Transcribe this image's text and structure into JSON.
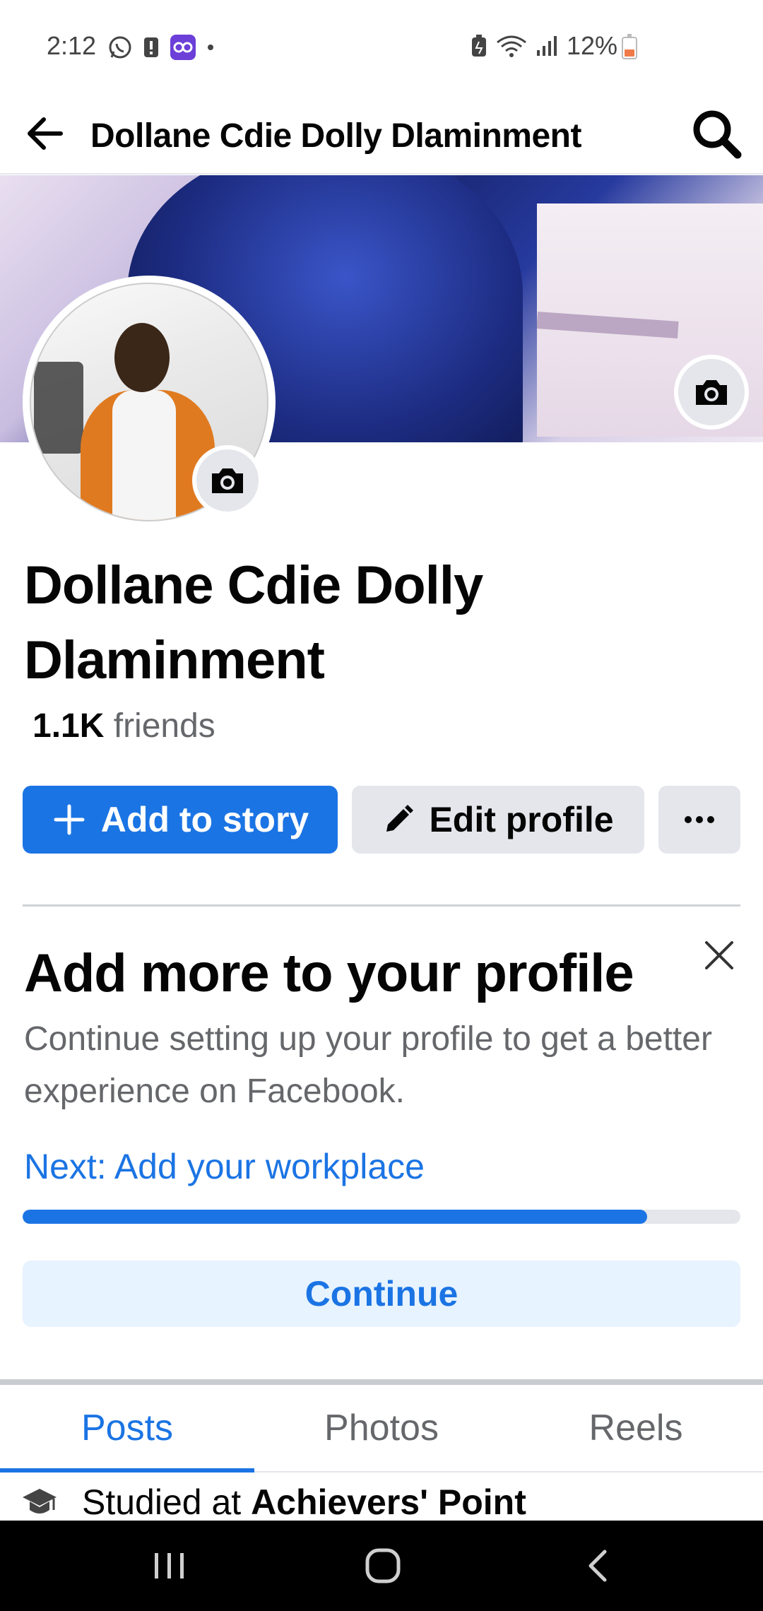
{
  "status_bar": {
    "time": "2:12",
    "battery_text": "12%",
    "left_icons": [
      "whatsapp-icon",
      "alert-icon",
      "app-icon",
      "dot-icon"
    ],
    "right_icons": [
      "battery-saver-icon",
      "wifi-icon",
      "signal-icon"
    ],
    "battery_level_color": "#f07b4a"
  },
  "header": {
    "title": "Dollane Cdie Dolly Dlaminment",
    "back_icon": "arrow-left-icon",
    "search_icon": "search-icon"
  },
  "profile": {
    "name": "Dollane Cdie Dolly Dlaminment",
    "friends_count": "1.1K",
    "friends_label": " friends"
  },
  "actions": {
    "add_story_label": "Add to story",
    "edit_profile_label": "Edit profile",
    "more_label": "···"
  },
  "profile_setup_card": {
    "title": "Add more to your profile",
    "description": "Continue setting up your profile to get a better experience on Facebook.",
    "next_step": "Next: Add your workplace",
    "progress_percent": 87,
    "continue_label": "Continue"
  },
  "tabs": [
    {
      "label": "Posts",
      "active": true
    },
    {
      "label": "Photos",
      "active": false
    },
    {
      "label": "Reels",
      "active": false
    }
  ],
  "intro": {
    "studied_prefix": "Studied at ",
    "studied_place": "Achievers' Point"
  },
  "colors": {
    "accent": "#1b74e4",
    "secondary_button": "#e4e6eb",
    "muted_text": "#65676b"
  }
}
